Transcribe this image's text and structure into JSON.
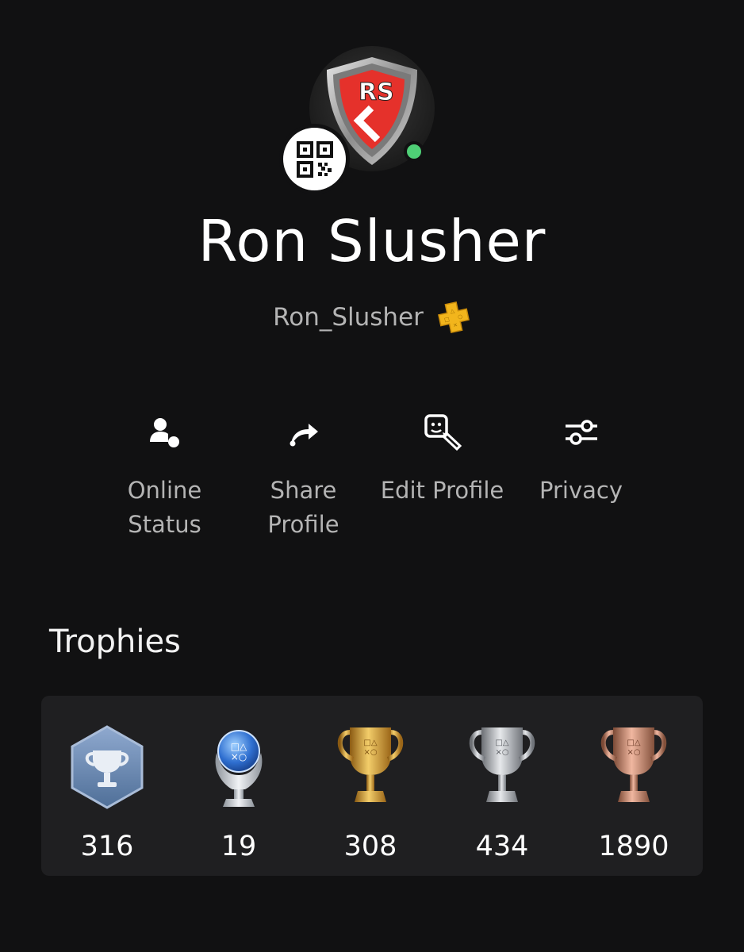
{
  "profile": {
    "display_name": "Ron Slusher",
    "online_id": "Ron_Slusher",
    "online_status_color": "#4fcf76",
    "avatar_icon": "rs-shield-avatar",
    "plus_badge_icon": "ps-plus-icon",
    "plus_badge_color": "#f2b51c"
  },
  "actions": [
    {
      "label": "Online\nStatus",
      "icon": "online-status-icon"
    },
    {
      "label": "Share\nProfile",
      "icon": "share-arrow-icon"
    },
    {
      "label": "Edit Profile",
      "icon": "edit-profile-icon"
    },
    {
      "label": "Privacy",
      "icon": "sliders-icon"
    }
  ],
  "trophies": {
    "heading": "Trophies",
    "items": [
      {
        "kind": "level",
        "count": "316",
        "icon": "trophy-level-icon",
        "color": "#6f8fb8"
      },
      {
        "kind": "platinum",
        "count": "19",
        "icon": "platinum-trophy-icon",
        "color": "#3a7bd5"
      },
      {
        "kind": "gold",
        "count": "308",
        "icon": "gold-trophy-icon",
        "color": "#d4a13a"
      },
      {
        "kind": "silver",
        "count": "434",
        "icon": "silver-trophy-icon",
        "color": "#b9bcc2"
      },
      {
        "kind": "bronze",
        "count": "1890",
        "icon": "bronze-trophy-icon",
        "color": "#c98a6e"
      }
    ]
  }
}
